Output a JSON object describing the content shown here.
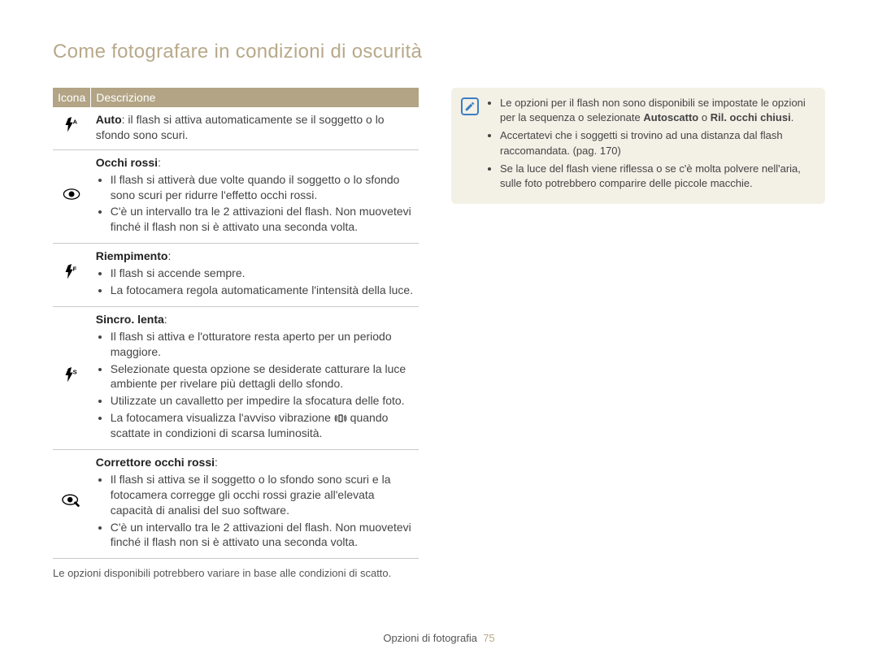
{
  "section_title": "Come fotografare in condizioni di oscurità",
  "table": {
    "head_icon": "Icona",
    "head_desc": "Descrizione",
    "rows": [
      {
        "icon": "flash-auto",
        "title": "Auto",
        "title_after": ": il flash si attiva automaticamente se il soggetto o lo sfondo sono scuri."
      },
      {
        "icon": "eye",
        "title": "Occhi rossi",
        "title_after": ":",
        "bullets": [
          "Il flash si attiverà due volte quando il soggetto o lo sfondo sono scuri per ridurre l'effetto occhi rossi.",
          "C'è un intervallo tra le 2 attivazioni del flash. Non muovetevi finché il flash non si è attivato una seconda volta."
        ]
      },
      {
        "icon": "flash-fill",
        "title": "Riempimento",
        "title_after": ":",
        "bullets": [
          "Il flash si accende sempre.",
          "La fotocamera regola automaticamente l'intensità della luce."
        ]
      },
      {
        "icon": "flash-slow",
        "title": "Sincro. lenta",
        "title_after": ":",
        "bullets": [
          "Il flash si attiva e l'otturatore resta aperto per un periodo maggiore.",
          "Selezionate questa opzione se desiderate catturare la luce ambiente per rivelare più dettagli dello sfondo.",
          "Utilizzate un cavalletto per impedire la sfocatura delle foto.",
          "La fotocamera visualizza l'avviso vibrazione  quando scattate in condizioni di scarsa luminosità."
        ],
        "has_inline_shake_icon": true
      },
      {
        "icon": "eye-brush",
        "title": "Correttore occhi rossi",
        "title_after": ":",
        "bullets": [
          "Il flash si attiva se il soggetto o lo sfondo sono scuri e la fotocamera corregge gli occhi rossi grazie all'elevata capacità di analisi del suo software.",
          "C'è un intervallo tra le 2 attivazioni del flash. Non muovetevi finché il flash non si è attivato una seconda volta."
        ]
      }
    ]
  },
  "footnote": "Le opzioni disponibili potrebbero variare in base alle condizioni di scatto.",
  "note_box": {
    "bullets": [
      "Le opzioni per il flash non sono disponibili se impostate le opzioni per la sequenza o selezionate Autoscatto o Ril. occhi chiusi.",
      "Accertatevi che i soggetti si trovino ad una distanza dal flash raccomandata. (pag. 170)",
      "Se la luce del flash viene riflessa o se c'è molta polvere nell'aria, sulle foto potrebbero comparire delle piccole macchie."
    ],
    "bold_parts": {
      "0": [
        "Autoscatto",
        "Ril. occhi chiusi"
      ]
    }
  },
  "footer": {
    "text": "Opzioni di fotografia",
    "page": "75"
  }
}
